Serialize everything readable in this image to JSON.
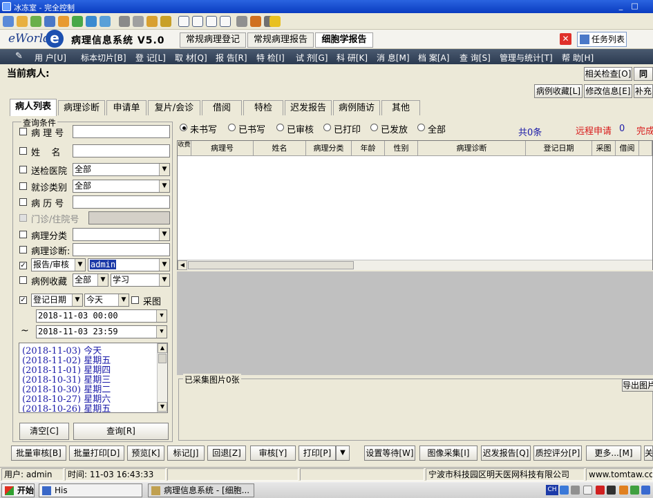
{
  "window": {
    "title": "冰冻室 - 完全控制",
    "minimize": "_",
    "maximize": "□"
  },
  "brand": {
    "logo": "eWorld",
    "logo_e": "e",
    "system_title": "病理信息系统 V5.0"
  },
  "top_tabs": [
    {
      "label": "常规病理登记"
    },
    {
      "label": "常规病理报告"
    },
    {
      "label": "细胞学报告"
    }
  ],
  "close_label": "✕",
  "task_list": "任务列表",
  "menu": [
    {
      "label": "用 户[U]"
    },
    {
      "label": "标本切片[B]"
    },
    {
      "label": "登 记[L]"
    },
    {
      "label": "取 材[Q]"
    },
    {
      "label": "报 告[R]"
    },
    {
      "label": "特 检[I]"
    },
    {
      "label": "试 剂[G]"
    },
    {
      "label": "科 研[K]"
    },
    {
      "label": "消 息[M]"
    },
    {
      "label": "档 案[A]"
    },
    {
      "label": "查 询[S]"
    },
    {
      "label": "管理与统计[T]"
    },
    {
      "label": "帮 助[H]"
    }
  ],
  "current_patient": "当前病人:",
  "right_buttons": {
    "related_check": "相关检查[O]",
    "sync": "同",
    "case_fav": "病例收藏[L]",
    "edit_info": "修改信息[E]",
    "supplement": "补充"
  },
  "second_tabs": [
    {
      "label": "病人列表"
    },
    {
      "label": "病理诊断"
    },
    {
      "label": "申请单"
    },
    {
      "label": "复片/会诊"
    },
    {
      "label": "借阅"
    },
    {
      "label": "特检"
    },
    {
      "label": "迟发报告"
    },
    {
      "label": "病例随访"
    },
    {
      "label": "其他"
    }
  ],
  "query": {
    "title": "查询条件",
    "pathology_no": "病 理 号",
    "name": "姓    名",
    "hospital": "送检医院",
    "hospital_value": "全部",
    "visit_type": "就诊类别",
    "visit_type_value": "全部",
    "medical_record": "病 历 号",
    "outpatient": "门诊/住院号",
    "path_class": "病理分类",
    "path_diag": "病理诊断:",
    "report_review": "报告/审核",
    "report_review_value": "admin",
    "case_fav": "病例收藏",
    "case_fav_value1": "全部",
    "case_fav_value2": "学习",
    "reg_date": "登记日期",
    "reg_date_range": "今天",
    "capture": "采图",
    "date_from": "2018-11-03 00:00",
    "tilde": "~",
    "date_to": "2018-11-03 23:59",
    "date_list": [
      {
        "date": "(2018-11-03)",
        "day": "今天"
      },
      {
        "date": "(2018-11-02)",
        "day": "星期五"
      },
      {
        "date": "(2018-11-01)",
        "day": "星期四"
      },
      {
        "date": "(2018-10-31)",
        "day": "星期三"
      },
      {
        "date": "(2018-10-30)",
        "day": "星期二"
      },
      {
        "date": "(2018-10-27)",
        "day": "星期六"
      },
      {
        "date": "(2018-10-26)",
        "day": "星期五"
      }
    ],
    "clear_btn": "清空[C]",
    "search_btn": "查询[R]"
  },
  "filters": {
    "options": [
      {
        "label": "未书写"
      },
      {
        "label": "已书写"
      },
      {
        "label": "已审核"
      },
      {
        "label": "已打印"
      },
      {
        "label": "已发放"
      },
      {
        "label": "全部"
      }
    ],
    "selected": "未书写",
    "total": "共0条",
    "remote": "远程申请",
    "remote_count": "0",
    "done": "完成"
  },
  "table": {
    "columns": [
      "收费",
      "病理号",
      "姓名",
      "病理分类",
      "年龄",
      "性别",
      "病理诊断",
      "登记日期",
      "采图",
      "借阅"
    ]
  },
  "images": {
    "title": "已采集图片0张",
    "export": "导出图片"
  },
  "bottom_buttons": [
    {
      "label": "批量审核[B]"
    },
    {
      "label": "批量打印[D]"
    },
    {
      "label": "预览[K]"
    },
    {
      "label": "标记[J]"
    },
    {
      "label": "回退[Z]"
    },
    {
      "label": "审核[Y]"
    },
    {
      "label": "打印[P]"
    },
    {
      "label": "设置等待[W]"
    },
    {
      "label": "图像采集[I]"
    },
    {
      "label": "迟发报告[Q]"
    },
    {
      "label": "质控评分[P]"
    },
    {
      "label": "更多...[M]"
    },
    {
      "label": "关"
    }
  ],
  "print_dropdown": "▼",
  "status": {
    "user": "用户: admin",
    "time": "时间: 11-03 16:43:33",
    "company": "宁波市科技园区明天医网科技有限公司",
    "site": "www.tomtaw.com"
  },
  "taskbar": {
    "start": "开始",
    "his": "His",
    "window": "病理信息系统 - [细胞...",
    "tray_ch": "CH"
  },
  "colors": {
    "accent": "#1c4fb0",
    "menu_bg": "#3a4a60",
    "red": "#e0302a",
    "link_blue": "#1a1aa8"
  }
}
